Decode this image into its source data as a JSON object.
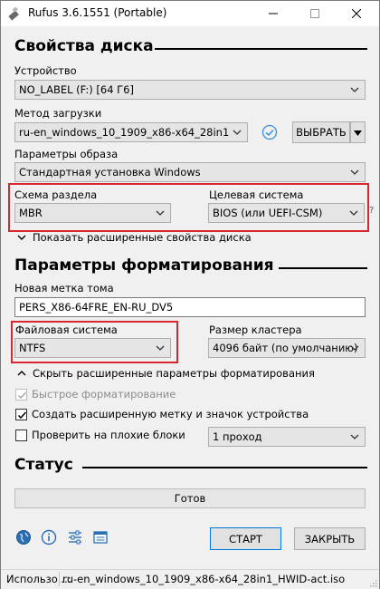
{
  "window": {
    "title": "Rufus 3.6.1551 (Portable)",
    "controls": {
      "minimize": "—",
      "maximize": "☐",
      "close": "✕"
    }
  },
  "drive_properties": {
    "heading": "Свойства диска",
    "device": {
      "label": "Устройство",
      "value": "NO_LABEL (F:) [64 Г6]"
    },
    "boot_selection": {
      "label": "Метод загрузки",
      "value": "ru-en_windows_10_1909_x86-x64_28in1_HWI",
      "select_button": "ВЫБРАТЬ"
    },
    "image_option": {
      "label": "Параметры образа",
      "value": "Стандартная установка Windows"
    },
    "partition_scheme": {
      "label": "Схема раздела",
      "value": "MBR"
    },
    "target_system": {
      "label": "Целевая система",
      "value": "BIOS (или UEFI-CSM)",
      "help": "?"
    },
    "advanced_toggle": "Показать расширенные свойства диска"
  },
  "format_options": {
    "heading": "Параметры форматирования",
    "volume_label": {
      "label": "Новая метка тома",
      "value": "PERS_X86-64FRE_EN-RU_DV5"
    },
    "file_system": {
      "label": "Файловая система",
      "value": "NTFS"
    },
    "cluster_size": {
      "label": "Размер кластера",
      "value": "4096 байт (по умолчанию)"
    },
    "advanced_toggle": "Скрыть расширенные параметры форматирования",
    "quick_format": {
      "label": "Быстрое форматирование",
      "checked": true,
      "enabled": false
    },
    "extended_label": {
      "label": "Создать расширенную метку и значок устройства",
      "checked": true
    },
    "bad_blocks": {
      "label": "Проверить на плохие блоки",
      "checked": false,
      "passes": "1 проход"
    }
  },
  "status": {
    "heading": "Статус",
    "progress_text": "Готов",
    "progress": 0
  },
  "actions": {
    "start": "СТАРТ",
    "close": "ЗАКРЫТЬ"
  },
  "statusbar": {
    "left": "Использо...:",
    "right": "ru-en_windows_10_1909_x86-x64_28in1_HWID-act.iso"
  },
  "colors": {
    "highlight": "#d9262f",
    "accent": "#0078d7",
    "check_blue": "#3c8fd6"
  }
}
